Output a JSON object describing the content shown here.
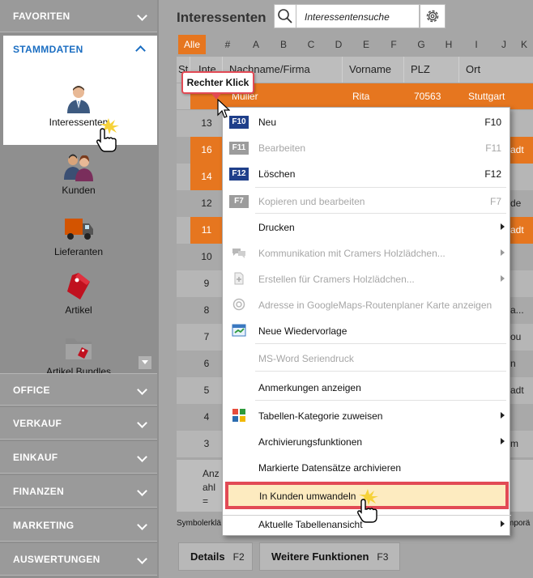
{
  "sidebar": {
    "favoriten": "FAVORITEN",
    "stammdaten": "STAMMDATEN",
    "items": [
      {
        "label": "Interessenten",
        "icon": "person-icon"
      },
      {
        "label": "Kunden",
        "icon": "people-icon"
      },
      {
        "label": "Lieferanten",
        "icon": "truck-icon"
      },
      {
        "label": "Artikel",
        "icon": "tag-icon"
      },
      {
        "label": "Artikel Bundles",
        "icon": "folder-tag-icon"
      }
    ],
    "sections": [
      "OFFICE",
      "VERKAUF",
      "EINKAUF",
      "FINANZEN",
      "MARKETING",
      "AUSWERTUNGEN"
    ]
  },
  "main": {
    "title": "Interessenten",
    "search_placeholder": "Interessentensuche",
    "alpha_tabs": [
      "Alle",
      "#",
      "A",
      "B",
      "C",
      "D",
      "E",
      "F",
      "G",
      "H",
      "I",
      "J",
      "K"
    ],
    "columns": [
      "St",
      "Inte",
      "Nachname/Firma",
      "Vorname",
      "PLZ",
      "Ort"
    ],
    "selected_row": {
      "name": "Müller",
      "vorname": "Rita",
      "plz": "70563",
      "ort": "Stuttgart"
    },
    "rows": [
      {
        "num": "13",
        "tail": "",
        "num_orange": false,
        "tail_orange": false
      },
      {
        "num": "16",
        "tail": "adt",
        "num_orange": true,
        "tail_orange": true
      },
      {
        "num": "14",
        "tail": "",
        "num_orange": true,
        "tail_orange": false
      },
      {
        "num": "12",
        "tail": "de",
        "num_orange": false,
        "tail_orange": false
      },
      {
        "num": "11",
        "tail": "adt",
        "num_orange": true,
        "tail_orange": true
      },
      {
        "num": "10",
        "tail": "",
        "num_orange": false,
        "tail_orange": false
      },
      {
        "num": "9",
        "tail": "",
        "num_orange": false,
        "tail_orange": false
      },
      {
        "num": "8",
        "tail": "a...",
        "num_orange": false,
        "tail_orange": false
      },
      {
        "num": "7",
        "tail": "ou",
        "num_orange": false,
        "tail_orange": false
      },
      {
        "num": "6",
        "tail": "n",
        "num_orange": false,
        "tail_orange": false
      },
      {
        "num": "5",
        "tail": "adt",
        "num_orange": false,
        "tail_orange": false
      },
      {
        "num": "4",
        "tail": "",
        "num_orange": false,
        "tail_orange": false
      },
      {
        "num": "3",
        "tail": "m",
        "num_orange": false,
        "tail_orange": false
      }
    ],
    "footer_lines": [
      "Anz",
      "ahl",
      "="
    ],
    "symbol_left": "Symbolerklä",
    "symbol_right": "mporä",
    "btn_details": "Details",
    "btn_details_key": "F2",
    "btn_more": "Weitere Funktionen",
    "btn_more_key": "F3"
  },
  "callout": "Rechter Klick",
  "context_menu": {
    "items": [
      {
        "label": "Neu",
        "fkey": "F10",
        "shortcut": "F10"
      },
      {
        "label": "Bearbeiten",
        "fkey": "F11",
        "shortcut": "F11"
      },
      {
        "label": "Löschen",
        "fkey": "F12",
        "shortcut": "F12"
      },
      {
        "label": "Kopieren und bearbeiten",
        "fkey": "F7",
        "shortcut": "F7"
      },
      {
        "label": "Drucken"
      },
      {
        "label": "Kommunikation mit Cramers Holzlädchen..."
      },
      {
        "label": "Erstellen für Cramers Holzlädchen..."
      },
      {
        "label": "Adresse in GoogleMaps-Routenplaner Karte anzeigen"
      },
      {
        "label": "Neue Wiedervorlage"
      },
      {
        "label": "MS-Word Seriendruck"
      },
      {
        "label": "Anmerkungen anzeigen"
      },
      {
        "label": "Tabellen-Kategorie zuweisen"
      },
      {
        "label": "Archivierungsfunktionen"
      },
      {
        "label": "Markierte Datensätze archivieren"
      },
      {
        "label": "In Kunden umwandeln"
      },
      {
        "label": "Aktuelle Tabellenansicht"
      }
    ]
  },
  "colors": {
    "accent_orange": "#e6761f",
    "highlight_red": "#e24a55",
    "fkey_blue": "#1f3f8a",
    "link_blue": "#1b6ec2"
  }
}
